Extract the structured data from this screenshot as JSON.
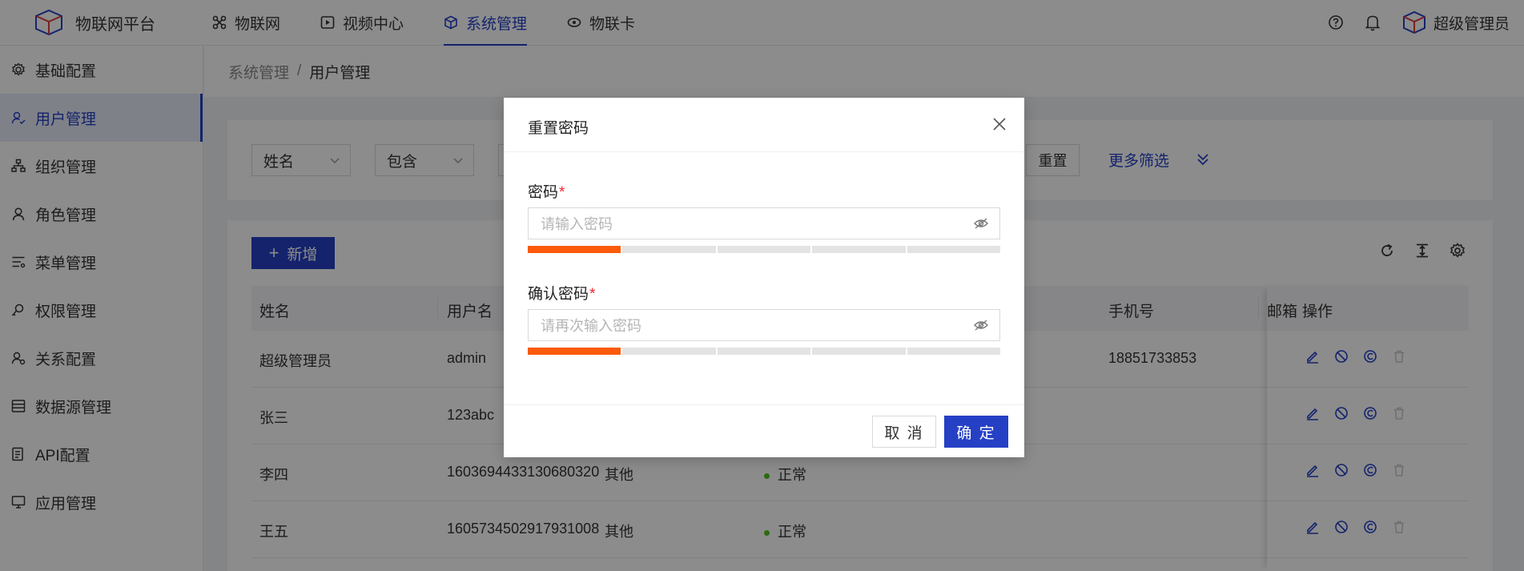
{
  "app": {
    "brand": "物联网平台"
  },
  "nav": [
    {
      "label": "物联网",
      "icon": "iot-icon"
    },
    {
      "label": "视频中心",
      "icon": "video-icon"
    },
    {
      "label": "系统管理",
      "icon": "system-icon",
      "active": true
    },
    {
      "label": "物联卡",
      "icon": "card-icon"
    }
  ],
  "user": {
    "name": "超级管理员"
  },
  "sidebar": {
    "items": [
      {
        "label": "基础配置",
        "icon": "gear-icon"
      },
      {
        "label": "用户管理",
        "icon": "users-icon",
        "active": true
      },
      {
        "label": "组织管理",
        "icon": "org-icon"
      },
      {
        "label": "角色管理",
        "icon": "role-icon"
      },
      {
        "label": "菜单管理",
        "icon": "menu-icon"
      },
      {
        "label": "权限管理",
        "icon": "permission-icon"
      },
      {
        "label": "关系配置",
        "icon": "relation-icon"
      },
      {
        "label": "数据源管理",
        "icon": "datasource-icon"
      },
      {
        "label": "API配置",
        "icon": "api-icon"
      },
      {
        "label": "应用管理",
        "icon": "app-icon"
      }
    ]
  },
  "breadcrumb": {
    "root": "系统管理",
    "separator": "/",
    "current": "用户管理"
  },
  "filter": {
    "field_select": "姓名",
    "operator_select": "包含",
    "reset_label": "重置",
    "more_label": "更多筛选"
  },
  "table": {
    "add_label": "新增",
    "columns": [
      "姓名",
      "用户名",
      "手机号",
      "邮箱",
      "操作"
    ],
    "rows": [
      {
        "name": "超级管理员",
        "username": "admin",
        "type": "",
        "status": "",
        "phone": "18851733853"
      },
      {
        "name": "张三",
        "username": "123abc",
        "type": "",
        "status": "",
        "phone": ""
      },
      {
        "name": "李四",
        "username": "1603694433130680320",
        "type": "其他",
        "status": "正常",
        "phone": ""
      },
      {
        "name": "王五",
        "username": "1605734502917931008",
        "type": "其他",
        "status": "正常",
        "phone": ""
      }
    ]
  },
  "modal": {
    "title": "重置密码",
    "password_label": "密码",
    "password_placeholder": "请输入密码",
    "confirm_label": "确认密码",
    "confirm_placeholder": "请再次输入密码",
    "required_mark": "*",
    "strength_filled_segments": 1,
    "strength_total_segments": 5,
    "cancel_label": "取 消",
    "ok_label": "确 定"
  },
  "colors": {
    "primary": "#2540c5",
    "strength": "#fa5a0a",
    "status_ok": "#52c41a",
    "required": "#f5222d"
  }
}
